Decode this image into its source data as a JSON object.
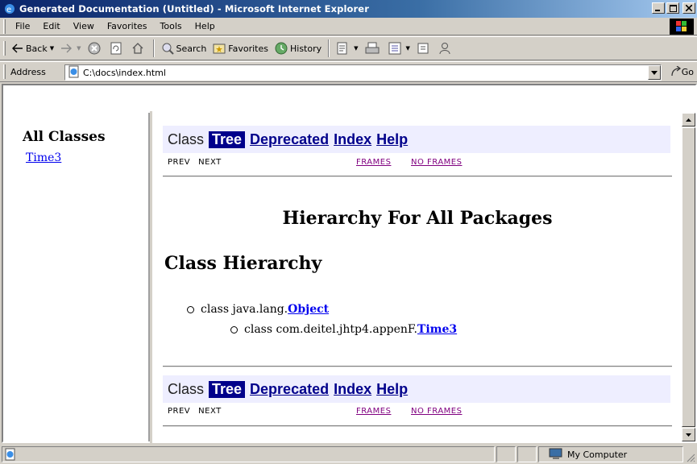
{
  "window": {
    "title": "Generated Documentation (Untitled) - Microsoft Internet Explorer"
  },
  "menu": [
    "File",
    "Edit",
    "View",
    "Favorites",
    "Tools",
    "Help"
  ],
  "toolbar": {
    "back": "Back",
    "search": "Search",
    "favorites": "Favorites",
    "history": "History"
  },
  "address": {
    "label": "Address",
    "value": "C:\\docs\\index.html",
    "go": "Go"
  },
  "left_frame": {
    "heading": "All Classes",
    "classes": [
      "Time3"
    ]
  },
  "nav": {
    "class": "Class",
    "tree": "Tree",
    "deprecated": "Deprecated",
    "index": "Index",
    "help": "Help",
    "prev": "PREV",
    "next": "NEXT",
    "frames": "FRAMES",
    "no_frames": "NO FRAMES"
  },
  "main": {
    "title": "Hierarchy For All Packages",
    "subtitle": "Class Hierarchy",
    "tree": [
      {
        "prefix": "class java.lang.",
        "link": "Object"
      },
      {
        "prefix": "class com.deitel.jhtp4.appenF.",
        "link": "Time3"
      }
    ]
  },
  "status": {
    "zone": "My Computer"
  },
  "colors": {
    "titlebar": "#0a246a",
    "nav_bg": "#eeeeff",
    "nav_active": "#00008b",
    "link": "#0000ee",
    "visited": "#800080"
  }
}
